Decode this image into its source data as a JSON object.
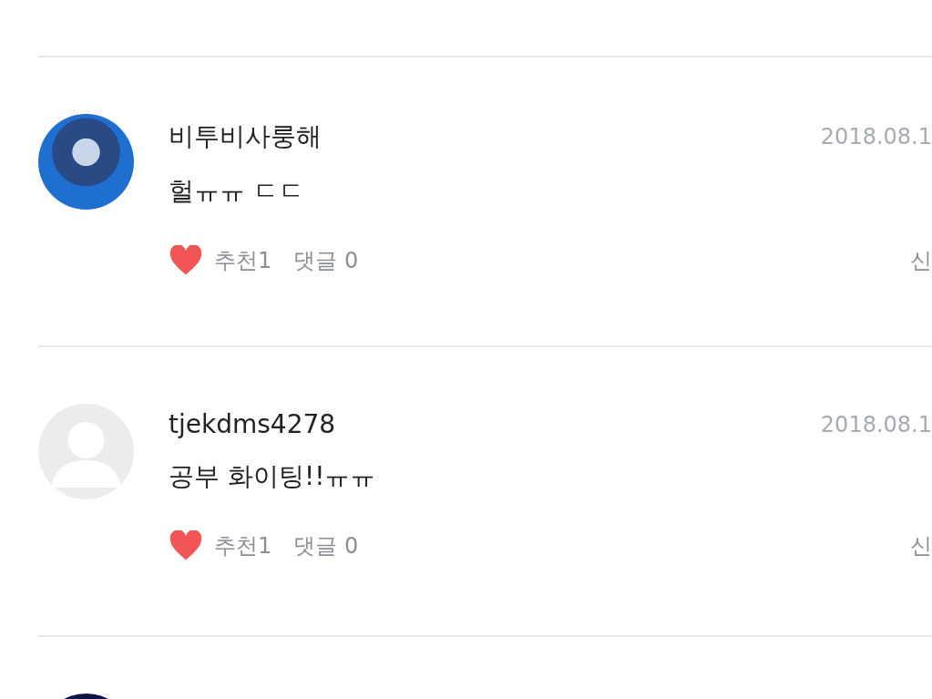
{
  "comments": [
    {
      "kind": "photo",
      "author": "비투비사룽해",
      "date": "2018.08.1",
      "text": "헐ㅠㅠ ㄷㄷ",
      "likes": "추천1",
      "replies": "댓글 0",
      "report": "신"
    },
    {
      "kind": "default",
      "author": "tjekdms4278",
      "date": "2018.08.1",
      "text": "공부 화이팅!!ㅠㅠ",
      "likes": "추천1",
      "replies": "댓글 0",
      "report": "신"
    },
    {
      "kind": "dark"
    }
  ]
}
